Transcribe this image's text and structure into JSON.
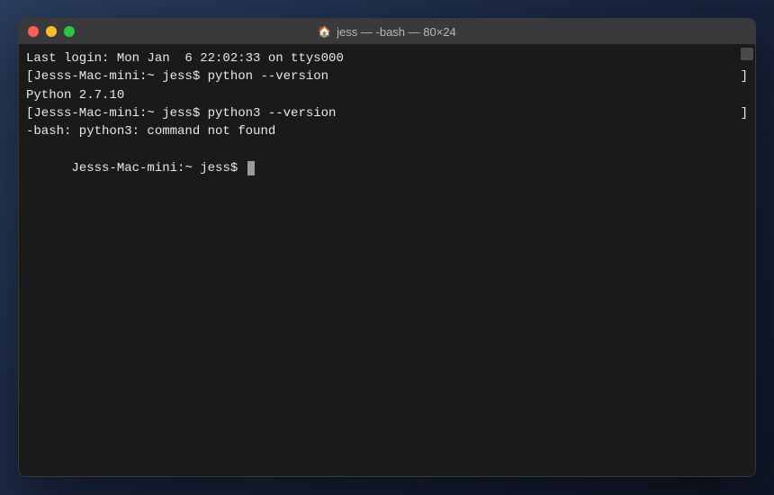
{
  "window": {
    "title": "jess — -bash — 80×24",
    "home_icon": "🏠"
  },
  "terminal": {
    "lines": {
      "last_login": "Last login: Mon Jan  6 22:02:33 on ttys000",
      "prompt1_left": "[Jesss-Mac-mini:~ jess$ python --version",
      "prompt1_right": "]",
      "output1": "Python 2.7.10",
      "prompt2_left": "[Jesss-Mac-mini:~ jess$ python3 --version",
      "prompt2_right": "]",
      "output2": "-bash: python3: command not found",
      "prompt3": "Jesss-Mac-mini:~ jess$ "
    }
  }
}
